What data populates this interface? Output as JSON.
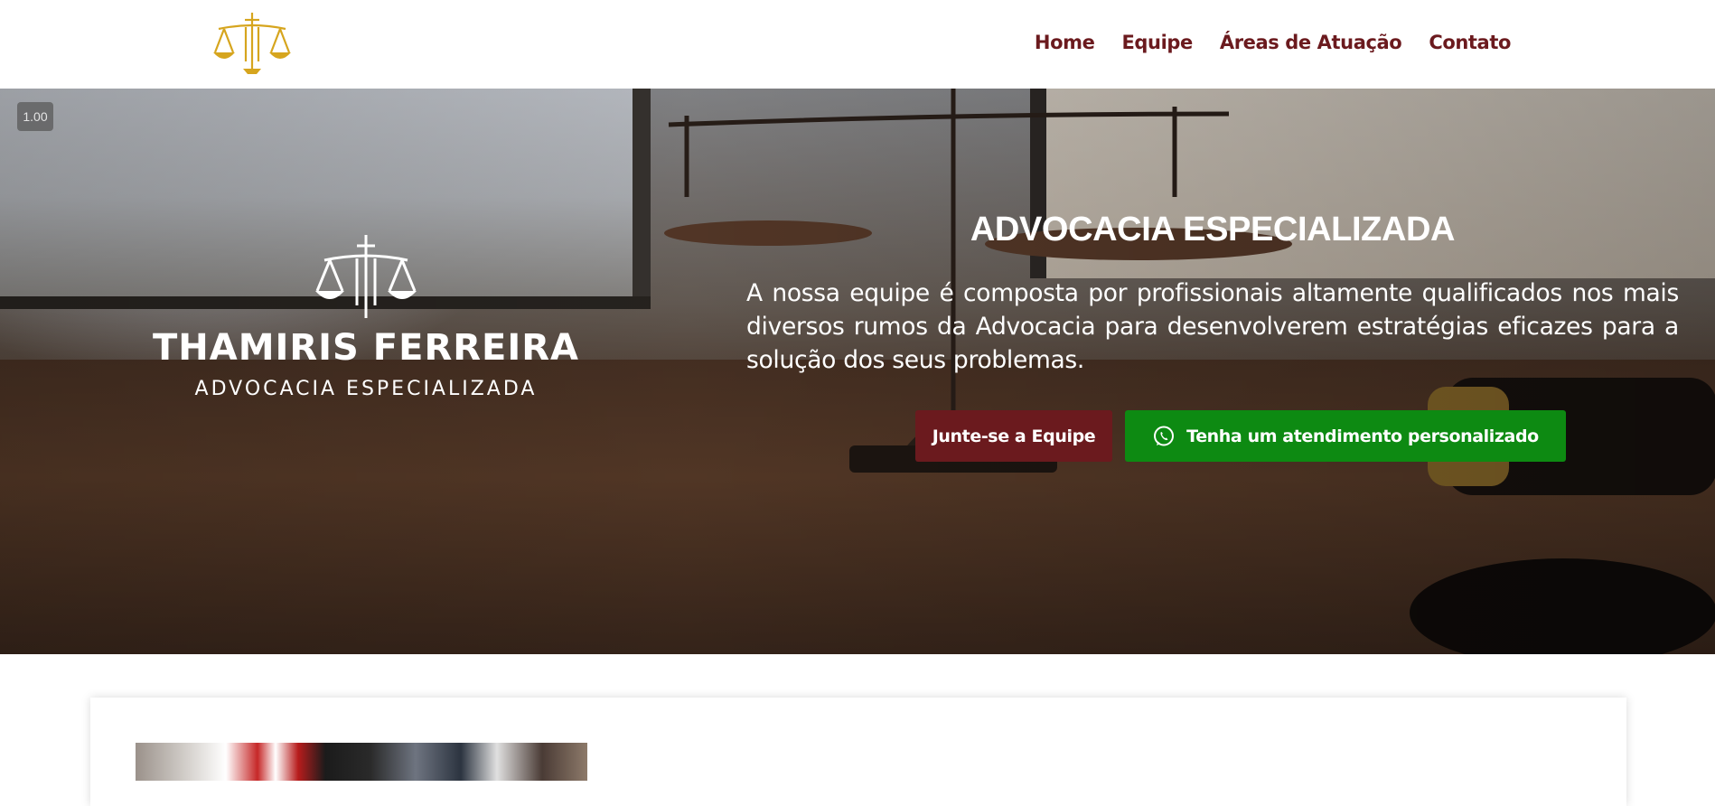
{
  "header": {
    "logo_icon": "scales-of-justice-icon",
    "logo_color": "#d6a51e",
    "nav": [
      {
        "label": "Home"
      },
      {
        "label": "Equipe"
      },
      {
        "label": "Áreas de Atuação"
      },
      {
        "label": "Contato"
      }
    ],
    "nav_color": "#6b1a1e"
  },
  "hero": {
    "zoom_badge": "1.00",
    "brand_name": "THAMIRIS FERREIRA",
    "brand_subtitle": "ADVOCACIA ESPECIALIZADA",
    "title": "ADVOCACIA ESPECIALIZADA",
    "text": "A nossa equipe é composta por profissionais altamente qualificados nos mais diversos rumos da Advocacia para desenvolverem estratégias eficazes para a solução dos seus problemas.",
    "buttons": {
      "team": {
        "label": "Junte-se a Equipe",
        "color": "#6b1a1e"
      },
      "whatsapp": {
        "label": "Tenha um atendimento personalizado",
        "icon": "whatsapp-icon",
        "color": "#0d8a12"
      }
    }
  }
}
